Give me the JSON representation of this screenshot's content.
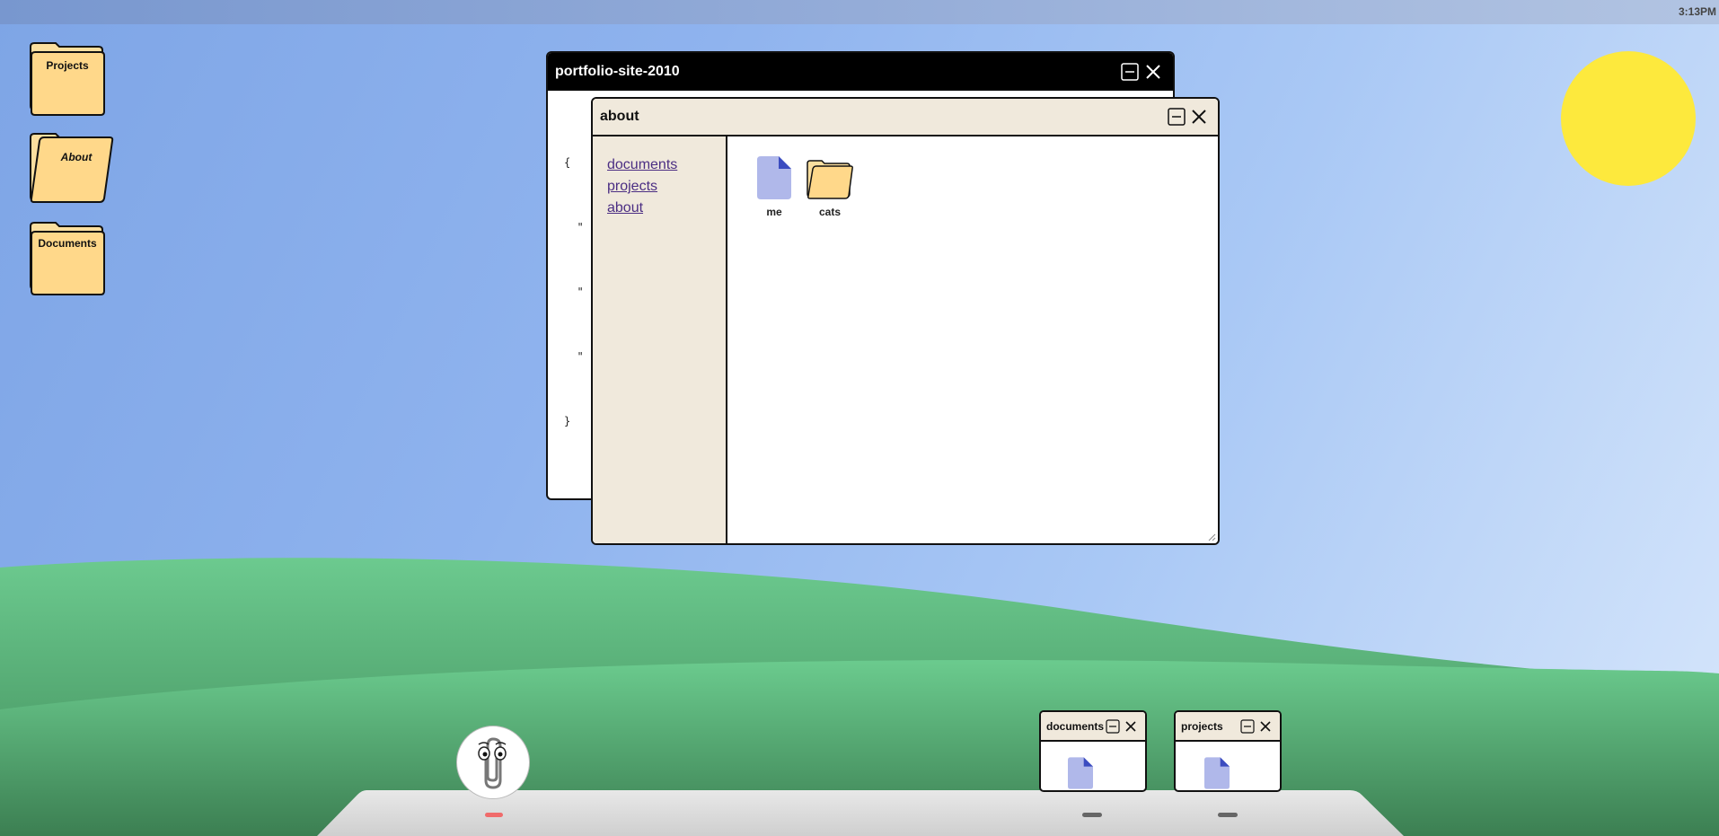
{
  "menubar": {
    "clock": "3:13PM"
  },
  "desktop_icons": [
    {
      "label": "Projects"
    },
    {
      "label": "About"
    },
    {
      "label": "Documents"
    }
  ],
  "windows": {
    "portfolio": {
      "title": "portfolio-site-2010",
      "json_lines": [
        "{",
        "  \"",
        "  \"",
        "  \"",
        "}"
      ]
    },
    "about": {
      "title": "about",
      "sidebar_links": [
        "documents",
        "projects",
        "about"
      ],
      "files": [
        {
          "name": "me",
          "icon": "document-icon"
        },
        {
          "name": "cats",
          "icon": "folder-icon"
        }
      ]
    }
  },
  "taskbar": {
    "previews": [
      {
        "title": "documents"
      },
      {
        "title": "projects"
      }
    ]
  },
  "colors": {
    "sky": "#8fb3ee",
    "sun": "#fde93d",
    "grass": "#6bcb8e",
    "folder": "#ffd88a",
    "window_chrome": "#f0e9dc",
    "link": "#4b2e83",
    "doc_icon": "#b0b8ea"
  }
}
